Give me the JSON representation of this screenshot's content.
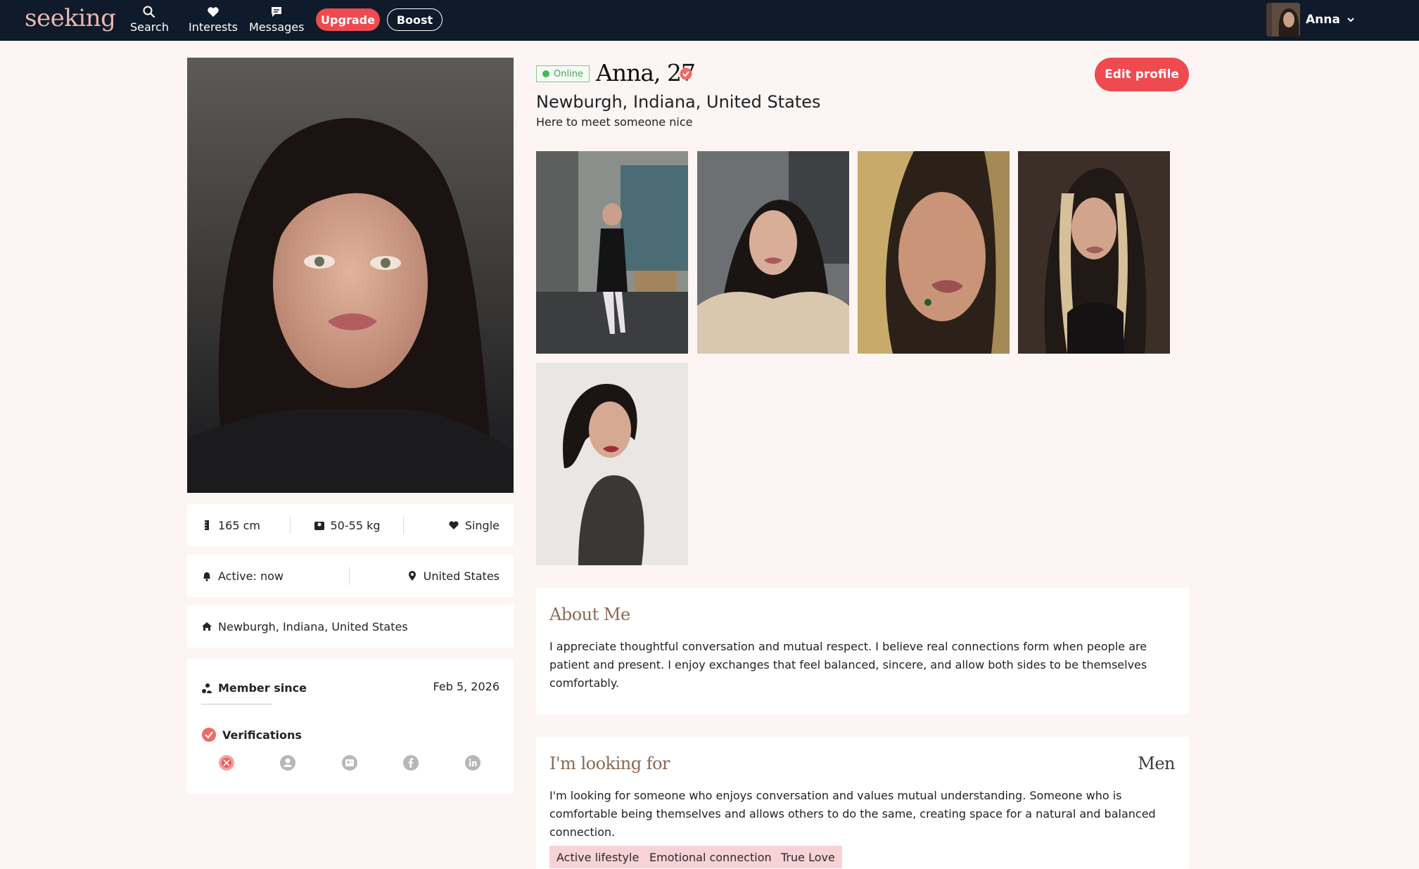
{
  "nav": {
    "logo": "seeking",
    "search_label": "Search",
    "interests_label": "Interests",
    "messages_label": "Messages",
    "upgrade_label": "Upgrade",
    "boost_label": "Boost",
    "user_name": "Anna"
  },
  "profile": {
    "online_label": "Online",
    "name_age": "Anna, 27",
    "location": "Newburgh, Indiana, United States",
    "tagline": "Here to meet someone nice",
    "edit_label": "Edit profile"
  },
  "stats": {
    "height": "165 cm",
    "weight": "50-55 kg",
    "relationship": "Single",
    "active": "Active: now",
    "country": "United States",
    "hometown": "Newburgh, Indiana, United States",
    "member_since_label": "Member since",
    "member_since_date": "Feb 5, 2026",
    "verifications_label": "Verifications"
  },
  "about": {
    "title": "About Me",
    "text": "I appreciate thoughtful conversation and mutual respect. I believe real connections form when people are patient and present. I enjoy exchanges that feel balanced, sincere, and allow both sides to be themselves comfortably."
  },
  "looking_for": {
    "title": "I'm looking for",
    "gender": "Men",
    "text": "I'm looking for someone who enjoys conversation and values mutual understanding. Someone who is comfortable being themselves and allows others to do the same, creating space for a natural and balanced connection.",
    "tags": [
      "Active lifestyle",
      "Emotional connection",
      "True Love"
    ]
  },
  "colors": {
    "nav_bg": "#0f1a2a",
    "accent": "#ef4a50",
    "page_bg": "#fcf5f3",
    "online_green": "#4bb55a",
    "section_title": "#8a6a55",
    "tag_bg": "#f7d3d6"
  }
}
